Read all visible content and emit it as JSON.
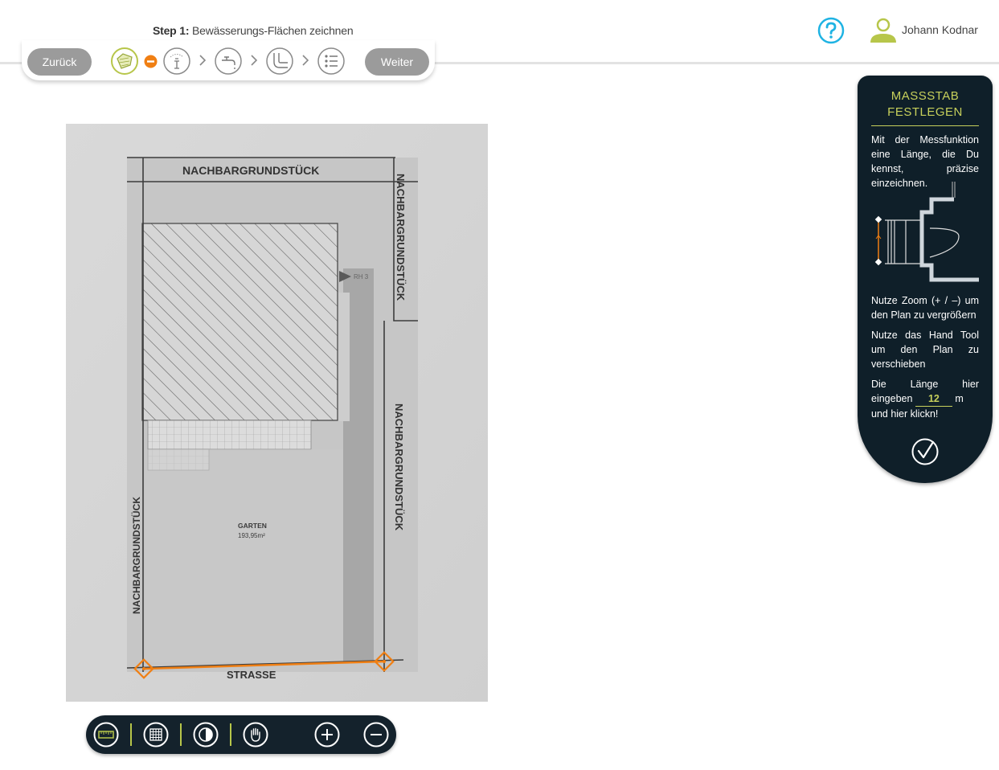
{
  "header": {
    "step_prefix": "Step 1:",
    "step_title": "Bewässerungs-Flächen zeichnen",
    "back_label": "Zurück",
    "next_label": "Weiter",
    "user_name": "Johann Kodnar"
  },
  "steps": [
    {
      "icon": "area-draw-icon",
      "state": "active"
    },
    {
      "icon": "remove-icon",
      "state": "active"
    },
    {
      "icon": "sprinkler-icon",
      "state": "inactive"
    },
    {
      "icon": "faucet-icon",
      "state": "inactive"
    },
    {
      "icon": "pipe-icon",
      "state": "inactive"
    },
    {
      "icon": "list-icon",
      "state": "inactive"
    }
  ],
  "plan": {
    "top_label": "NACHBARGRUNDSTÜCK",
    "right_top_label": "NACHBARGRUNDSTÜCK",
    "right_label": "NACHBARGRUNDSTÜCK",
    "left_label": "NACHBARGRUNDSTÜCK",
    "bottom_label": "STRASSE",
    "garden_label": "GARTEN",
    "garden_area": "193,95m²",
    "rh_label": "RH 3"
  },
  "panel": {
    "title_line1": "MASSSTAB",
    "title_line2": "FESTLEGEN",
    "text1": "Mit der Messfunktion eine Länge, die Du kennst, präzise einzeichnen.",
    "text2": "Nutze Zoom (+ / –) um den Plan zu vergrößern",
    "text3": "Nutze das Hand Tool um den Plan zu verschieben",
    "length_prefix": "Die Länge hier eingeben",
    "length_value": "12",
    "length_unit": "m",
    "length_suffix": "und hier klickn!"
  },
  "colors": {
    "accent_green": "#b7c64a",
    "accent_orange": "#f07f13",
    "panel_bg": "#0f1f29",
    "help_blue": "#1fb3e3"
  }
}
